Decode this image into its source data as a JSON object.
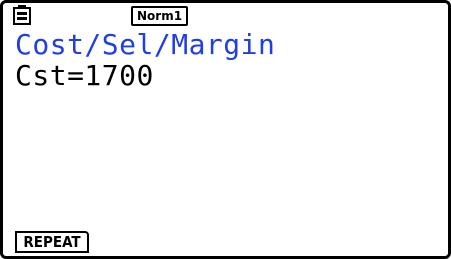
{
  "status_bar": {
    "battery_icon": "battery-icon",
    "mode_label": "Norm1"
  },
  "display": {
    "title": "Cost/Sel/Margin",
    "result_line": "Cst=1700"
  },
  "function_keys": {
    "f1_label": "REPEAT"
  },
  "colors": {
    "title_text": "#1f3fe0",
    "body_text": "#000000",
    "background": "#ffffff"
  }
}
